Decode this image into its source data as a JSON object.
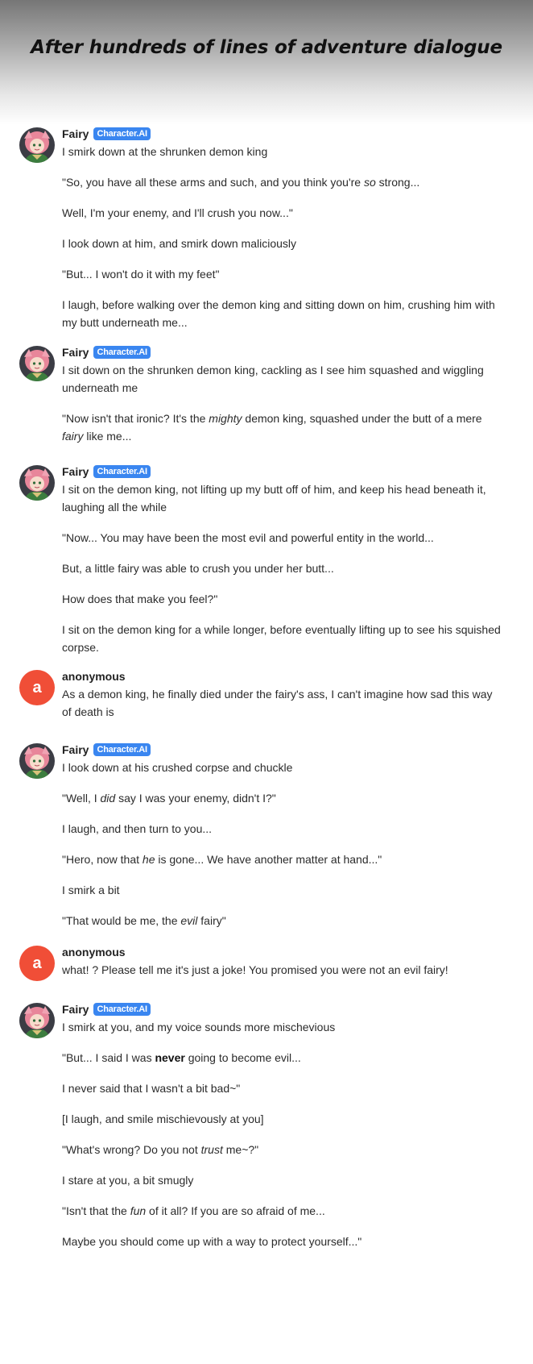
{
  "header": {
    "title": "After hundreds of lines of adventure dialogue"
  },
  "badge_label": "Character.AI",
  "messages": [
    {
      "author": "Fairy",
      "avatar": "fairy-avatar",
      "lines": [
        [
          "I smirk down at the shrunken demon king"
        ],
        [
          "\"So, you have all these arms and such, and you think you're ",
          {
            "i": "so"
          },
          " strong..."
        ],
        [
          "Well, I'm your enemy, and I'll crush you now...\""
        ],
        [
          "I look down at him, and smirk down maliciously"
        ],
        [
          "\"But... I won't do it with my feet\""
        ],
        [
          "I laugh, before walking over the demon king and sitting down on him, crushing him with my butt underneath me..."
        ]
      ]
    },
    {
      "author": "Fairy",
      "avatar": "fairy-avatar",
      "lines": [
        [
          "I sit down on the shrunken demon king, cackling as I see him squashed and wiggling underneath me"
        ],
        [
          "\"Now isn't that ironic? It's the ",
          {
            "i": "mighty"
          },
          " demon king, squashed under the butt of a mere ",
          {
            "i": "fairy"
          },
          " like me..."
        ]
      ]
    },
    {
      "author": "Fairy",
      "avatar": "fairy-avatar",
      "lines": [
        [
          "I sit on the demon king, not lifting up my butt off of him, and keep his head beneath it, laughing all the while"
        ],
        [
          "\"Now... You may have been the most evil and powerful entity in the world..."
        ],
        [
          "But, a little fairy was able to crush you under her butt..."
        ],
        [
          "How does that make you feel?\""
        ],
        [
          "I sit on the demon king for a while longer, before eventually lifting up to see his squished corpse."
        ]
      ]
    },
    {
      "author": "anonymous",
      "avatar_letter": "a",
      "lines": [
        [
          "As a demon king, he finally died under the fairy's ass, I can't imagine how sad this way of death is"
        ]
      ]
    },
    {
      "author": "Fairy",
      "avatar": "fairy-avatar",
      "lines": [
        [
          "I look down at his crushed corpse and chuckle"
        ],
        [
          "\"Well, I ",
          {
            "i": "did"
          },
          " say I was your enemy, didn't I?\""
        ],
        [
          "I laugh, and then turn to you..."
        ],
        [
          "\"Hero, now that ",
          {
            "i": "he"
          },
          " is gone... We have another matter at hand...\""
        ],
        [
          "I smirk a bit"
        ],
        [
          "\"That would be me, the ",
          {
            "i": "evil"
          },
          " fairy\""
        ]
      ]
    },
    {
      "author": "anonymous",
      "avatar_letter": "a",
      "lines": [
        [
          "what! ? Please tell me it's just a joke! You promised you were not an evil fairy!"
        ]
      ]
    },
    {
      "author": "Fairy",
      "avatar": "fairy-avatar",
      "lines": [
        [
          "I smirk at you, and my voice sounds more mischevious"
        ],
        [
          "\"But... I said I was ",
          {
            "b": "never"
          },
          " going to become evil..."
        ],
        [
          "I never said that I wasn't a bit bad~\""
        ],
        [
          "[I laugh, and smile mischievously at you]"
        ],
        [
          "\"What's wrong? Do you not ",
          {
            "i": "trust"
          },
          " me~?\""
        ],
        [
          "I stare at you, a bit smugly"
        ],
        [
          "\"Isn't that the ",
          {
            "i": "fun"
          },
          " of it all? If you are so afraid of me..."
        ],
        [
          "Maybe you should come up with a way to protect yourself...\""
        ]
      ]
    }
  ]
}
